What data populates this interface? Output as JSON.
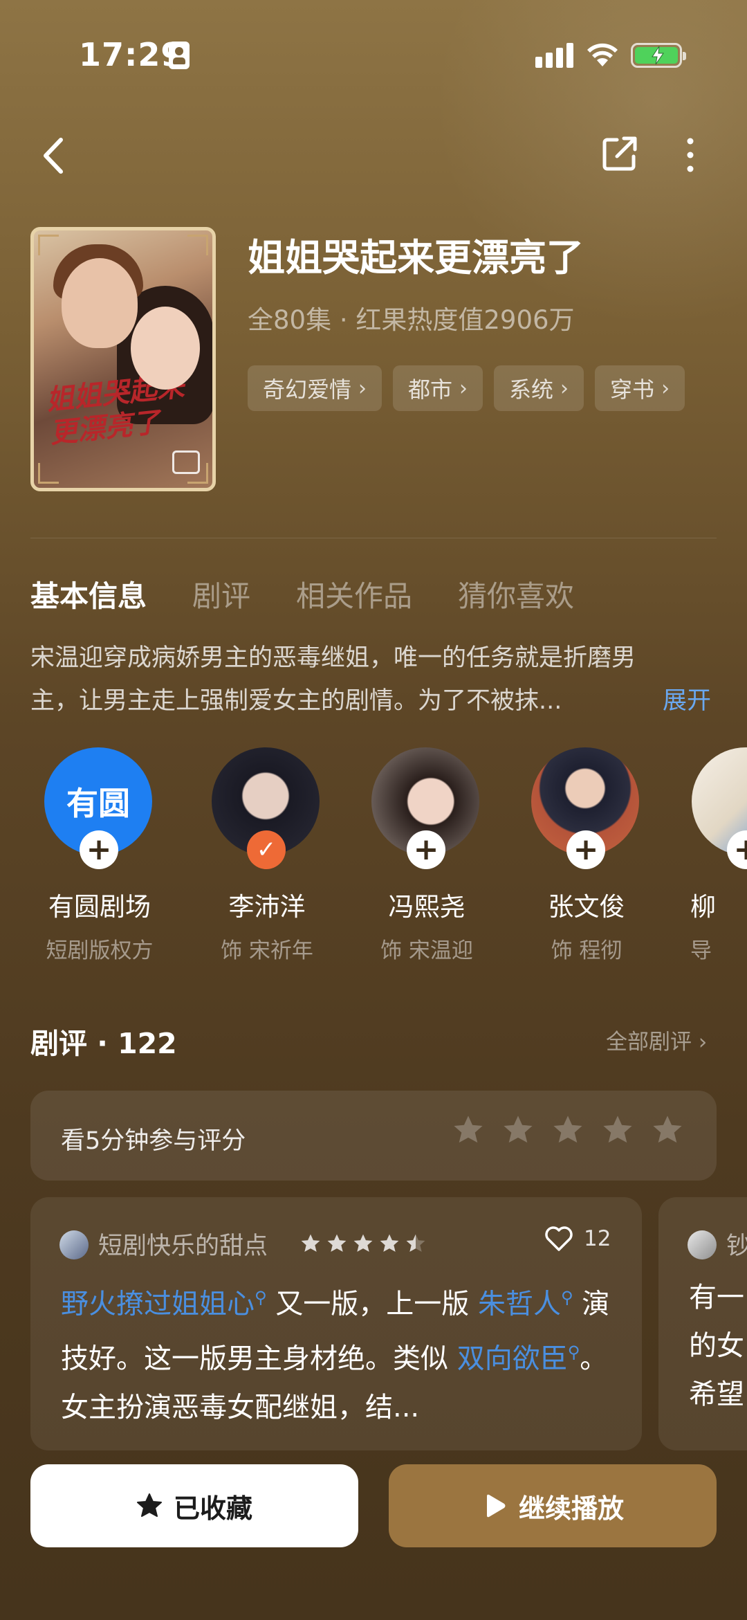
{
  "status_bar": {
    "time": "17:29"
  },
  "drama": {
    "title": "姐姐哭起来更漂亮了",
    "meta": "全80集 · 红果热度值2906万",
    "cover_art_text": "姐姐哭起来更漂亮了",
    "tags": [
      {
        "label": "奇幻爱情"
      },
      {
        "label": "都市"
      },
      {
        "label": "系统"
      },
      {
        "label": "穿书"
      }
    ]
  },
  "tabs": [
    {
      "label": "基本信息",
      "active": true
    },
    {
      "label": "剧评",
      "active": false
    },
    {
      "label": "相关作品",
      "active": false
    },
    {
      "label": "猜你喜欢",
      "active": false
    }
  ],
  "synopsis": {
    "line1": "宋温迎穿成病娇男主的恶毒继姐，唯一的任务就是折磨男",
    "line2": "主，让男主走上强制爱女主的剧情。为了不被抹...",
    "expand_label": "展开"
  },
  "cast": [
    {
      "name": "有圆剧场",
      "role": "短剧版权方",
      "badge": "+",
      "logo_text": "有圆"
    },
    {
      "name": "李沛洋",
      "role": "饰 宋祈年",
      "badge": "✓"
    },
    {
      "name": "冯熙尧",
      "role": "饰 宋温迎",
      "badge": "+"
    },
    {
      "name": "张文俊",
      "role": "饰 程彻",
      "badge": "+"
    },
    {
      "name": "柳",
      "role": "导",
      "badge": "+"
    }
  ],
  "reviews": {
    "title": "剧评 · 122",
    "all_label": "全部剧评 ›",
    "rate_prompt": "看5分钟参与评分",
    "rate_stars": 5,
    "items": [
      {
        "user": "短剧快乐的甜点",
        "rating": 4.5,
        "likes": "12",
        "text_parts": [
          {
            "text": "野火撩过姐姐心",
            "link": true
          },
          {
            "text": " 又一版，上一版 ",
            "link": false
          },
          {
            "text": "朱哲人",
            "link": true
          },
          {
            "text": " 演技好。这一版男主身材绝。类似 ",
            "link": false
          },
          {
            "text": "双向欲臣",
            "link": true
          },
          {
            "text": "。女主扮演恶毒女配继姐，结...",
            "link": false
          }
        ]
      },
      {
        "user": "钞",
        "text_lines": [
          "有一",
          "的女",
          "希望"
        ]
      }
    ]
  },
  "actions": {
    "favorite_label": "已收藏",
    "play_label": "继续播放"
  },
  "colors": {
    "accent_link": "#4a8fe0",
    "expand": "#6aa8f0",
    "play_button": "#9b7540",
    "followed_badge": "#ee6a36",
    "battery": "#4fd25b"
  },
  "icons": [
    "back-icon",
    "share-icon",
    "more-icon",
    "star-icon",
    "play-icon",
    "heart-icon",
    "plus-icon",
    "check-icon"
  ]
}
